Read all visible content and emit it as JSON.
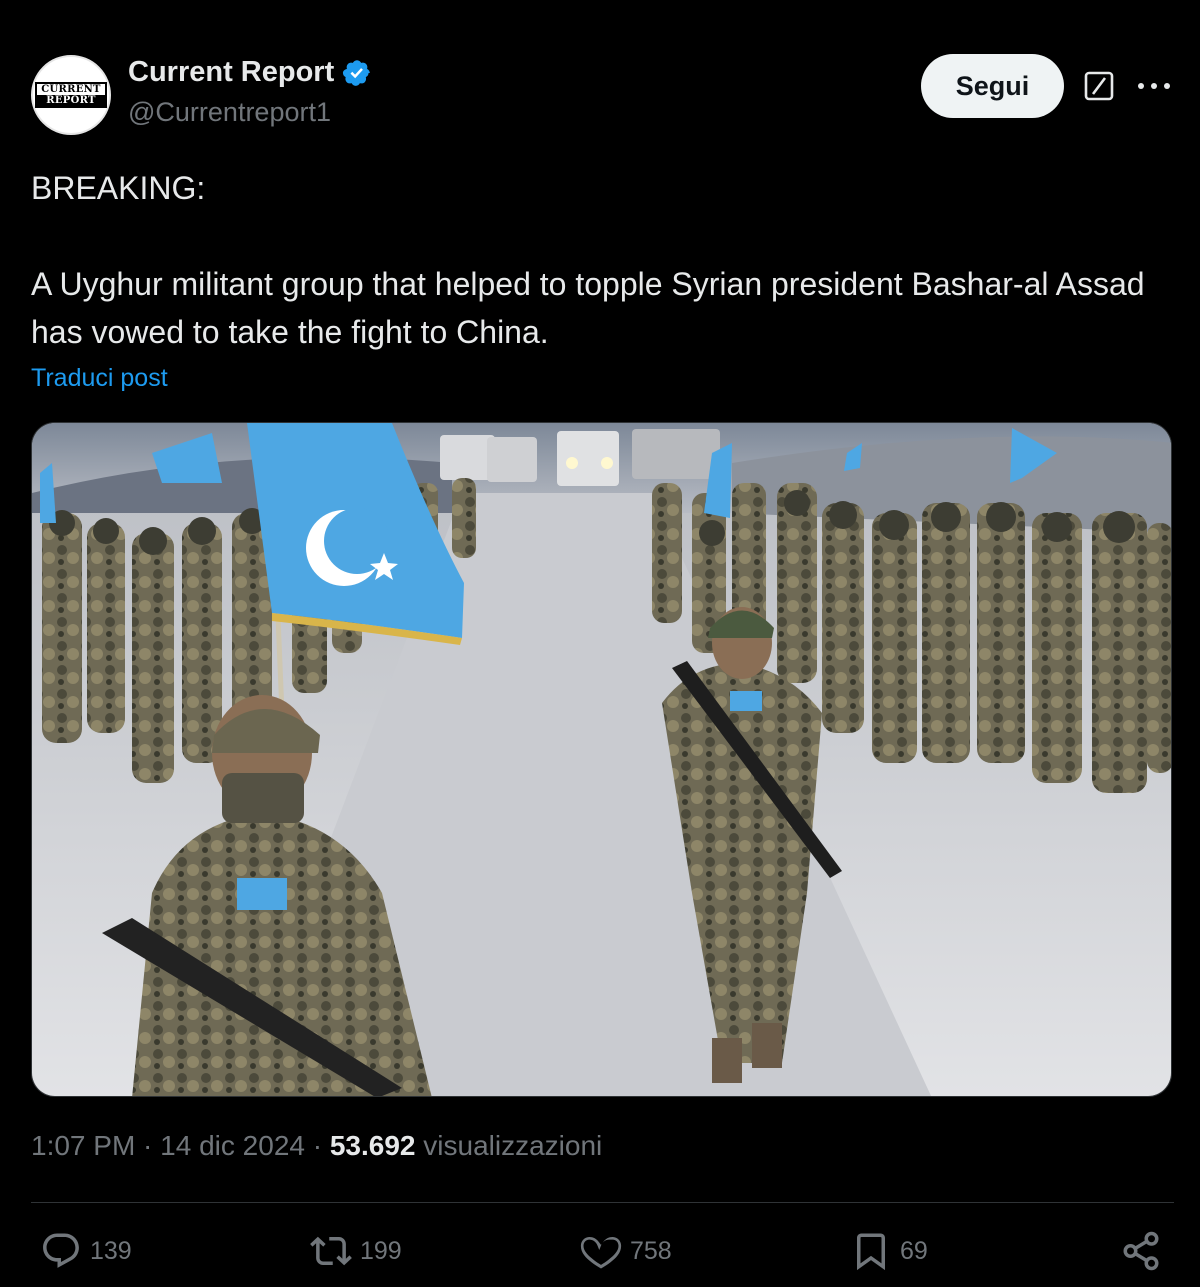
{
  "author": {
    "avatar_text_line1": "CURRENT",
    "avatar_text_line2": "REPORT",
    "display_name": "Current Report",
    "handle": "@Currentreport1",
    "verified": true
  },
  "header": {
    "follow_label": "Segui",
    "grok_icon": "grok-icon",
    "more_icon": "more-icon"
  },
  "post": {
    "line1": "BREAKING:",
    "body": "A Uyghur militant group that helped to topple Syrian president Bashar-al Assad has vowed to take the fight to China.",
    "translate_label": "Traduci post"
  },
  "meta": {
    "time": "1:07 PM",
    "sep1": " · ",
    "date": "14 dic 2024",
    "sep2": " · ",
    "views_count": "53.692",
    "views_label": " visualizzazioni"
  },
  "actions": {
    "replies": "139",
    "reposts": "199",
    "likes": "758",
    "bookmarks": "69"
  },
  "colors": {
    "background": "#000000",
    "text": "#e7e9ea",
    "muted": "#71767b",
    "link": "#1d9bf0",
    "verified": "#1d9bf0",
    "flag": "#4ea7e3"
  }
}
